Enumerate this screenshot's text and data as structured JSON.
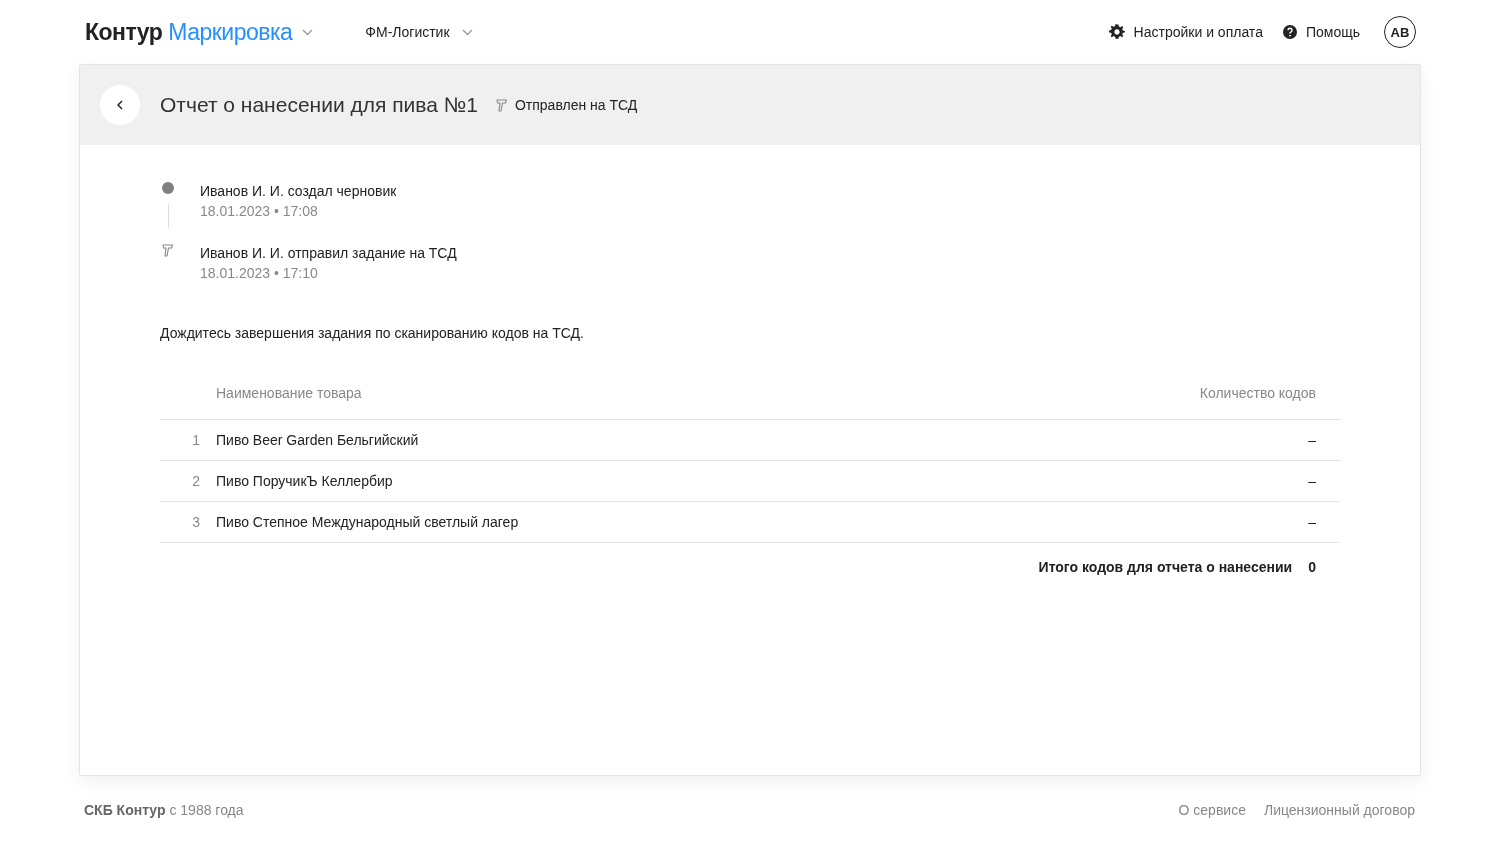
{
  "header": {
    "brand": "Контур",
    "product": "Маркировка",
    "organization": "ФМ-Логистик",
    "links": [
      {
        "kind": "settings",
        "label": "Настройки и оплата"
      },
      {
        "kind": "help",
        "label": "Помощь"
      }
    ],
    "avatar": "АВ"
  },
  "report": {
    "title": "Отчет о нанесении для пива №1",
    "status": "Отправлен на ТСД",
    "timeline": [
      {
        "kind": "dot",
        "text": "Иванов И. И. создал черновик",
        "time": "18.01.2023 • 17:08"
      },
      {
        "kind": "scanner",
        "text": "Иванов И. И. отправил задание на ТСД",
        "time": "18.01.2023 • 17:10"
      }
    ],
    "notice": "Дождитесь завершения задания по сканированию кодов на ТСД.",
    "table": {
      "columns": [
        "Наименование товара",
        "Количество кодов"
      ],
      "rows": [
        {
          "number": "1",
          "name": "Пиво Beer Garden Бельгийский",
          "count": "–"
        },
        {
          "number": "2",
          "name": "Пиво ПоручикЪ Келлербир",
          "count": "–"
        },
        {
          "number": "3",
          "name": "Пиво Степное Международный светлый лагер",
          "count": "–"
        }
      ],
      "total_label": "Итого кодов для отчета о нанесении",
      "total_value": "0"
    }
  },
  "footer": {
    "copyright": "**СКБ Контур** с 1988 года",
    "links": [
      "О сервисе",
      "Лицензионный договор"
    ]
  }
}
